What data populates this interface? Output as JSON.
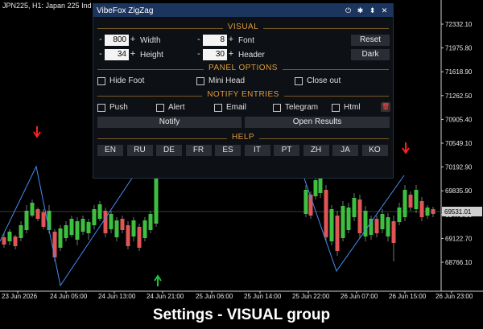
{
  "chart": {
    "symbol_title": "JPN225, H1:  Japan 225 Ind",
    "price_labels": [
      "72332.10",
      "71975.80",
      "71618.90",
      "71262.50",
      "70905.40",
      "70549.10",
      "70192.90",
      "69835.90",
      "69478.90",
      "69122.70",
      "68766.10"
    ],
    "current_price": "69531.01",
    "time_labels": [
      "23 Jun 2026",
      "24 Jun 05:00",
      "24 Jun 13:00",
      "24 Jun 21:00",
      "25 Jun 06:00",
      "25 Jun 14:00",
      "25 Jun 22:00",
      "26 Jun 07:00",
      "26 Jun 15:00",
      "26 Jun 23:00"
    ],
    "colors": {
      "up": "#3fbf3f",
      "down": "#e05555",
      "zigzag": "#4a8cf0",
      "arrow_down": "#ff2020",
      "arrow_up": "#20c040"
    }
  },
  "panel": {
    "title": "VibeFox ZigZag",
    "titlebar_icons": [
      "power-icon",
      "gear-icon",
      "move-icon",
      "close-icon"
    ],
    "visual": {
      "heading": "VISUAL",
      "width": {
        "value": "800",
        "label": "Width"
      },
      "height": {
        "value": "34",
        "label": "Height"
      },
      "font": {
        "value": "8",
        "label": "Font"
      },
      "header": {
        "value": "30",
        "label": "Header"
      },
      "reset_label": "Reset",
      "dark_label": "Dark"
    },
    "panel_options": {
      "heading": "PANEL OPTIONS",
      "hide_foot": "Hide Foot",
      "mini_head": "Mini Head",
      "close_out": "Close out"
    },
    "notify_entries": {
      "heading": "NOTIFY ENTRIES",
      "push": "Push",
      "alert": "Alert",
      "email": "Email",
      "telegram": "Telegram",
      "html": "Html",
      "notify_label": "Notify",
      "open_results_label": "Open Results"
    },
    "help": {
      "heading": "HELP",
      "languages": [
        "EN",
        "RU",
        "DE",
        "FR",
        "ES",
        "IT",
        "PT",
        "ZH",
        "JA",
        "KO"
      ]
    }
  },
  "caption": "Settings - VISUAL group"
}
